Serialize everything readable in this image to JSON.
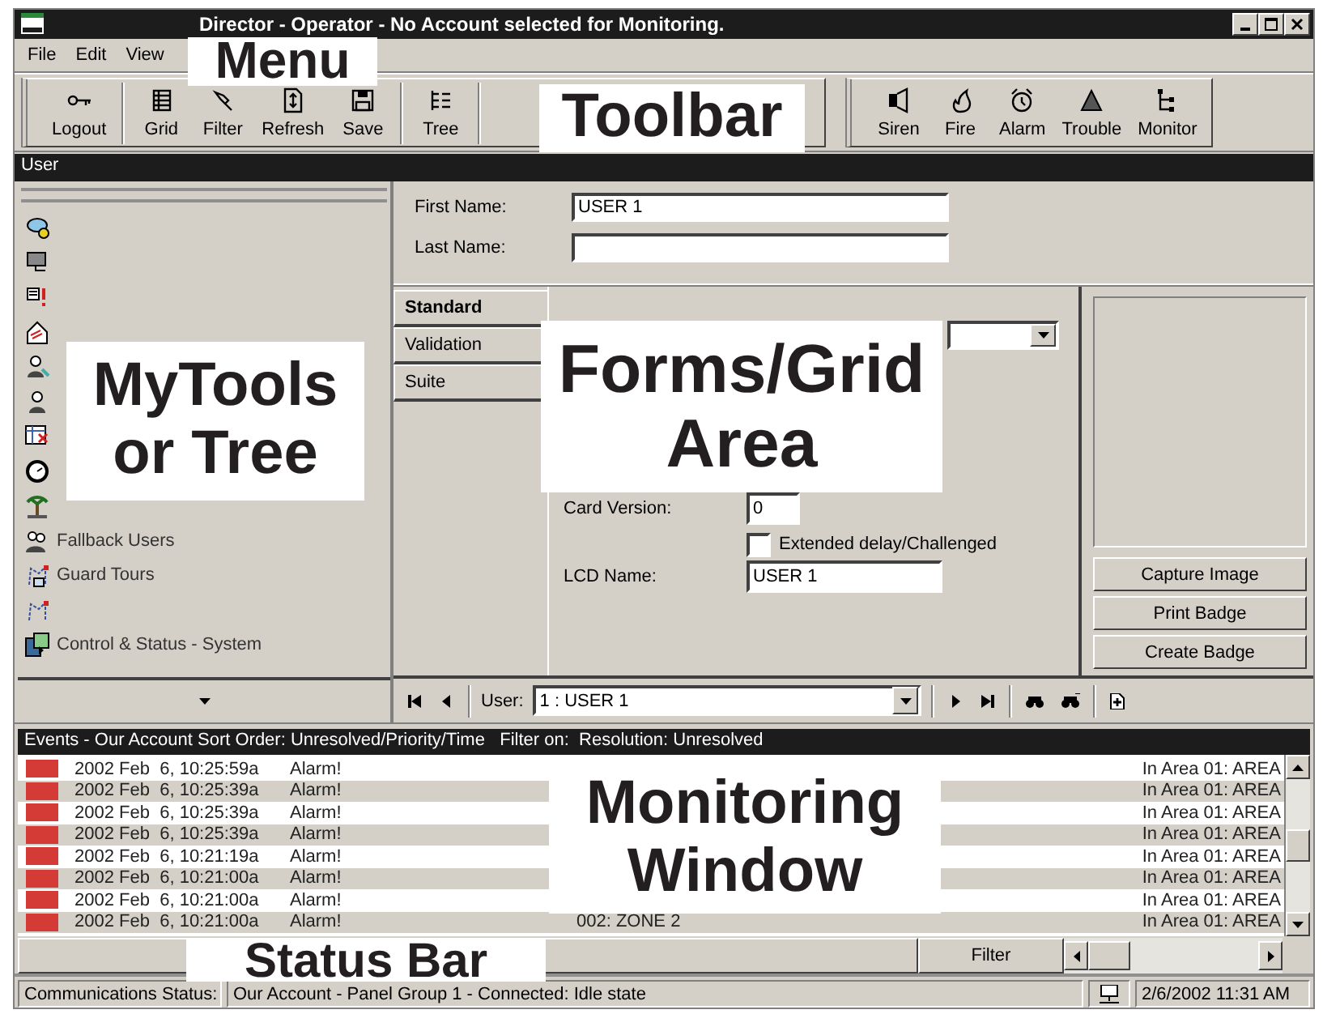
{
  "window": {
    "title": "Director - Operator - No Account selected for Monitoring."
  },
  "menu": [
    "File",
    "Edit",
    "View"
  ],
  "toolbar": {
    "left_groups": [
      [
        "Logout"
      ],
      [
        "Grid",
        "Filter",
        "Refresh",
        "Save"
      ],
      [
        "Tree"
      ]
    ],
    "right_group": [
      "Siren",
      "Fire",
      "Alarm",
      "Trouble",
      "Monitor"
    ]
  },
  "section_title": "User",
  "tree": {
    "items": [
      {
        "kind": "icon"
      },
      {
        "kind": "icon"
      },
      {
        "kind": "icon"
      },
      {
        "kind": "icon"
      },
      {
        "kind": "icon"
      },
      {
        "kind": "icon"
      },
      {
        "kind": "icon"
      },
      {
        "kind": "icon"
      },
      {
        "kind": "icon"
      },
      {
        "kind": "labeled",
        "label": "Fallback Users"
      },
      {
        "kind": "labeled",
        "label": "Guard Tours"
      },
      {
        "kind": "icon"
      },
      {
        "kind": "labeled",
        "label": "Control & Status - System"
      }
    ]
  },
  "form": {
    "first_name": {
      "label": "First Name:",
      "value": "USER 1"
    },
    "last_name": {
      "label": "Last Name:"
    },
    "tabs": [
      {
        "label": "Standard",
        "selected": true
      },
      {
        "label": "Validation",
        "selected": false
      },
      {
        "label": "Suite",
        "selected": false
      }
    ],
    "card_version": {
      "label": "Card Version:",
      "value": "0"
    },
    "checkbox": {
      "label": "Extended delay/Challenged",
      "checked": false
    },
    "lcd_name": {
      "label": "LCD Name:",
      "value": "USER 1"
    },
    "buttons": [
      "Capture Image",
      "Print Badge",
      "Create Badge"
    ]
  },
  "navigator": {
    "label": "User:",
    "value": "1 : USER 1"
  },
  "events": {
    "header": "Events - Our Account Sort Order: Unresolved/Priority/Time   Filter on:  Resolution: Unresolved",
    "rows": [
      {
        "time": "2002 Feb  6, 10:25:59a",
        "type": "Alarm!",
        "area": "In Area 01: AREA"
      },
      {
        "time": "2002 Feb  6, 10:25:39a",
        "type": "Alarm!",
        "area": "In Area 01: AREA"
      },
      {
        "time": "2002 Feb  6, 10:25:39a",
        "type": "Alarm!",
        "area": "In Area 01: AREA"
      },
      {
        "time": "2002 Feb  6, 10:25:39a",
        "type": "Alarm!",
        "area": "In Area 01: AREA"
      },
      {
        "time": "2002 Feb  6, 10:21:19a",
        "type": "Alarm!",
        "area": "In Area 01: AREA"
      },
      {
        "time": "2002 Feb  6, 10:21:00a",
        "type": "Alarm!",
        "area": "In Area 01: AREA"
      },
      {
        "time": "2002 Feb  6, 10:21:00a",
        "type": "Alarm!",
        "area": "In Area 01: AREA"
      },
      {
        "time": "2002 Feb  6, 10:21:00a",
        "type": "Alarm!",
        "zone": "002: ZONE 2",
        "area": "In Area 01: AREA"
      }
    ],
    "filter_button": "Filter"
  },
  "status_bar": {
    "label": "Communications Status:",
    "message": "Our Account - Panel Group 1 - Connected: Idle state",
    "datetime": "2/6/2002 11:31 AM"
  },
  "annotations": [
    "Menu",
    "Toolbar",
    "MyTools or Tree",
    "Forms/Grid Area",
    "Monitoring Window",
    "Status Bar"
  ]
}
